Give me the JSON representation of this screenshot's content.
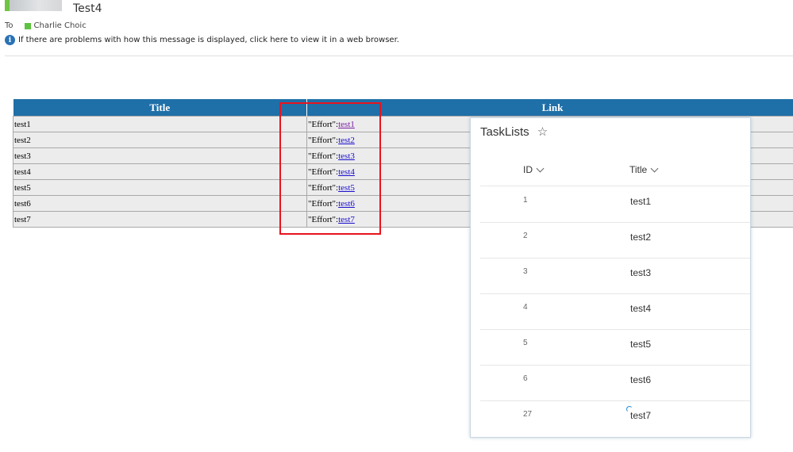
{
  "message": {
    "subject": "Test4",
    "to_label": "To",
    "recipient": "Charlie Choic",
    "info_text": "If there are problems with how this message is displayed, click here to view it in a web browser."
  },
  "mail_table": {
    "headers": [
      "Title",
      "Link"
    ],
    "rows": [
      {
        "title": "test1",
        "prefix": "\"Effort\":",
        "link": "test1"
      },
      {
        "title": "test2",
        "prefix": "\"Effort\":",
        "link": "test2"
      },
      {
        "title": "test3",
        "prefix": "\"Effort\":",
        "link": "test3"
      },
      {
        "title": "test4",
        "prefix": "\"Effort\":",
        "link": "test4"
      },
      {
        "title": "test5",
        "prefix": "\"Effort\":",
        "link": "test5"
      },
      {
        "title": "test6",
        "prefix": "\"Effort\":",
        "link": "test6"
      },
      {
        "title": "test7",
        "prefix": "\"Effort\":",
        "link": "test7"
      }
    ]
  },
  "tasklist": {
    "title": "TaskLists",
    "columns": [
      "ID",
      "Title"
    ],
    "rows": [
      {
        "id": "1",
        "title": "test1"
      },
      {
        "id": "2",
        "title": "test2"
      },
      {
        "id": "3",
        "title": "test3"
      },
      {
        "id": "4",
        "title": "test4"
      },
      {
        "id": "5",
        "title": "test5"
      },
      {
        "id": "6",
        "title": "test6"
      },
      {
        "id": "27",
        "title": "test7"
      }
    ]
  },
  "colors": {
    "table_header": "#1f6fa8",
    "highlight_box": "#e8141e",
    "presence": "#5cc33f",
    "info_icon": "#2a72b5"
  },
  "icons": [
    "info-icon",
    "star-icon",
    "chevron-down-icon",
    "loading-spinner-icon"
  ]
}
